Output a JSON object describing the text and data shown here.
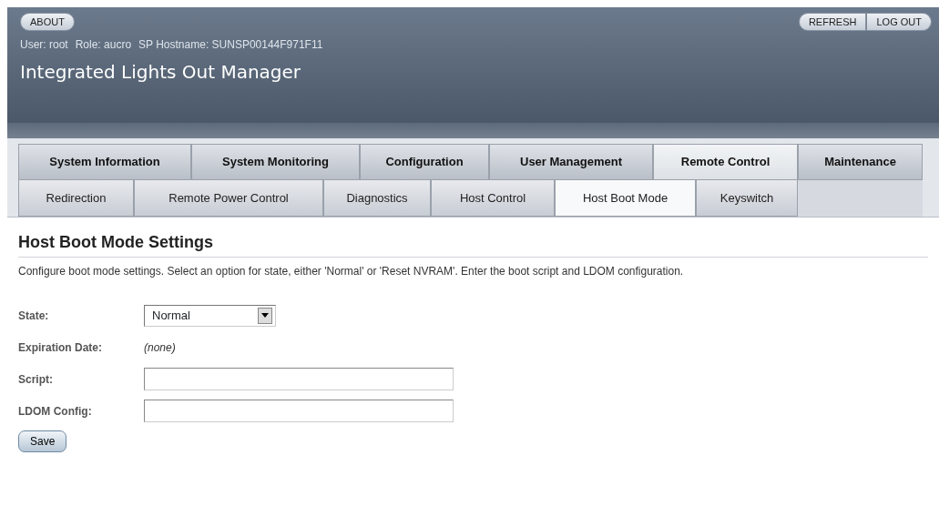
{
  "header": {
    "left_buttons": [
      "ABOUT"
    ],
    "right_buttons": [
      "REFRESH",
      "LOG OUT"
    ],
    "user_info": [
      {
        "label": "User:",
        "value": "root"
      },
      {
        "label": "Role:",
        "value": "aucro"
      },
      {
        "label": "SP Hostname:",
        "value": "SUNSP00144F971F11"
      }
    ],
    "title": "Integrated Lights Out Manager"
  },
  "tabs": [
    {
      "label": "System Information",
      "selected": false
    },
    {
      "label": "System Monitoring",
      "selected": false
    },
    {
      "label": "Configuration",
      "selected": false
    },
    {
      "label": "User Management",
      "selected": false
    },
    {
      "label": "Remote Control",
      "selected": true
    },
    {
      "label": "Maintenance",
      "selected": false
    }
  ],
  "subtabs": [
    {
      "label": "Redirection",
      "selected": false
    },
    {
      "label": "Remote Power Control",
      "selected": false
    },
    {
      "label": "Diagnostics",
      "selected": false
    },
    {
      "label": "Host Control",
      "selected": false
    },
    {
      "label": "Host Boot Mode",
      "selected": true
    },
    {
      "label": "Keyswitch",
      "selected": false
    }
  ],
  "content": {
    "heading": "Host Boot Mode Settings",
    "description": "Configure boot mode settings. Select an option for state, either 'Normal' or 'Reset NVRAM'. Enter the boot script and LDOM configuration.",
    "fields": [
      {
        "kind": "select",
        "label": "State:",
        "value": "Normal"
      },
      {
        "kind": "text",
        "label": "Expiration Date:",
        "value": "(none)"
      },
      {
        "kind": "input",
        "label": "Script:"
      },
      {
        "kind": "input",
        "label": "LDOM Config:"
      }
    ],
    "save_button": "Save"
  }
}
